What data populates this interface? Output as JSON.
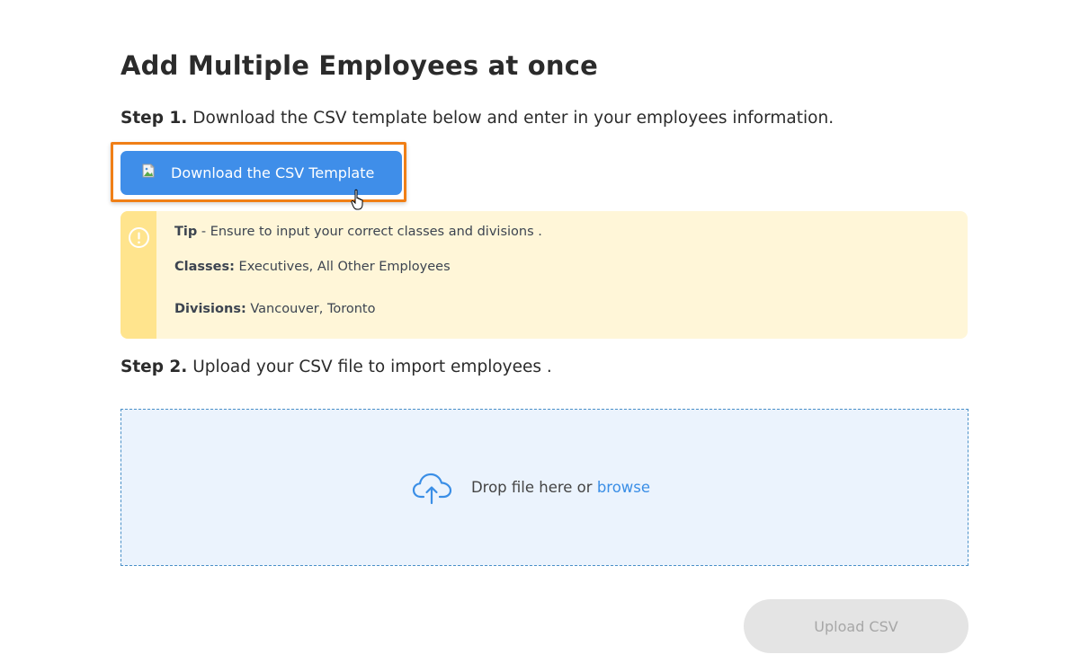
{
  "page": {
    "title": "Add Multiple Employees at once"
  },
  "step1": {
    "label": "Step 1.",
    "text": " Download the CSV template below and enter in your employees information.",
    "download_button_label": "Download the CSV Template"
  },
  "tip": {
    "title": "Tip",
    "text": " - Ensure to input your correct classes and divisions .",
    "classes_label": "Classes:",
    "classes_value": " Executives, All Other Employees",
    "divisions_label": "Divisions:",
    "divisions_value": " Vancouver, Toronto"
  },
  "step2": {
    "label": "Step 2.",
    "text": " Upload your CSV file to import employees ."
  },
  "dropzone": {
    "text": "Drop file here or ",
    "browse_label": "browse"
  },
  "upload_button": {
    "label": "Upload CSV",
    "enabled": false
  },
  "icons": {
    "download_button_image": "broken-image-icon",
    "tip": "alert-circle-icon",
    "dropzone": "cloud-upload-icon",
    "cursor": "hand-pointer-icon"
  },
  "colors": {
    "primary": "#3f8ee9",
    "highlight_border": "#f07f16",
    "tip_background": "#fff6d8",
    "tip_bar": "#ffe48d",
    "dropzone_background": "#ebf3fd",
    "link": "#3a8ee6",
    "disabled_button": "#e4e4e4"
  }
}
